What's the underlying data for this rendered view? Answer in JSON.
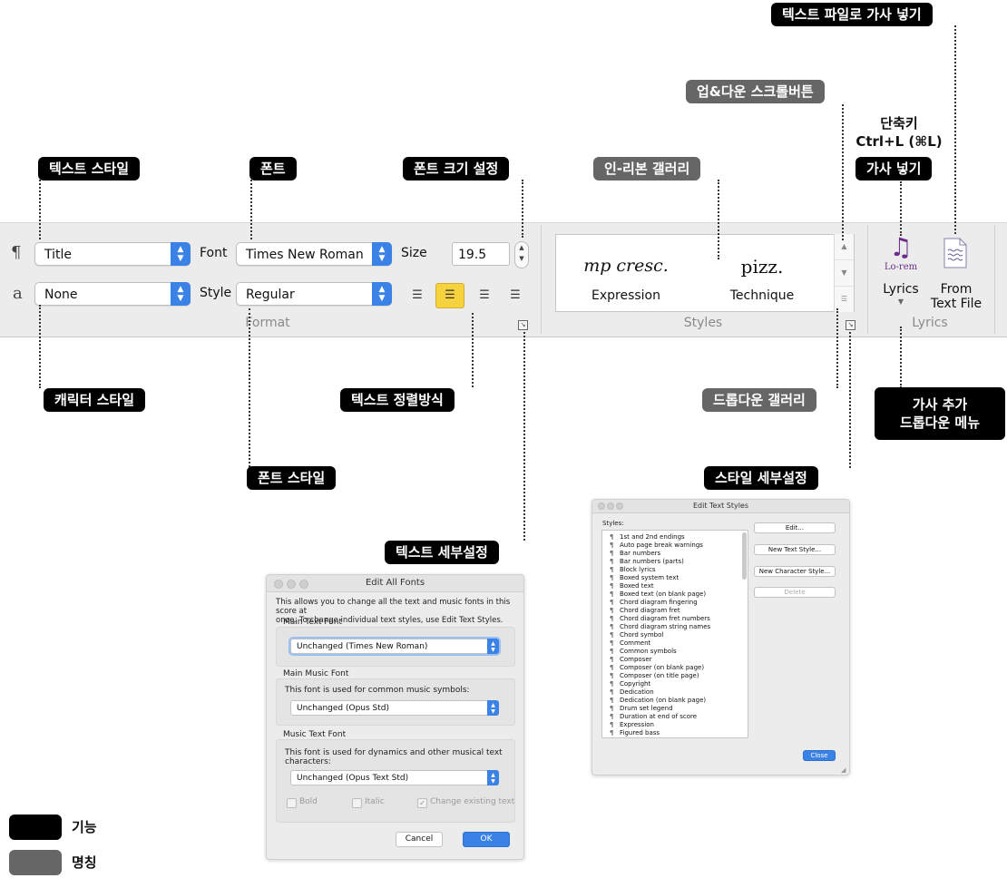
{
  "ribbon": {
    "format": {
      "group_label": "Format",
      "paragraph_icon": "¶",
      "char_icon": "a",
      "text_style": "Title",
      "char_style": "None",
      "font_label": "Font",
      "font_value": "Times New Roman",
      "style_label": "Style",
      "style_value": "Regular",
      "size_label": "Size",
      "size_value": "19.5",
      "align_selected": "center"
    },
    "styles": {
      "group_label": "Styles",
      "items": [
        {
          "preview": "mp cresc.",
          "label": "Expression"
        },
        {
          "preview": "pizz.",
          "label": "Technique"
        }
      ]
    },
    "lyrics": {
      "group_label": "Lyrics",
      "lyrics_icon_text": "Lo-rem",
      "lyrics_button": "Lyrics",
      "from_file_line1": "From",
      "from_file_line2": "Text File"
    }
  },
  "callouts": {
    "text_style": "텍스트 스타일",
    "font": "폰트",
    "font_size": "폰트 크기 설정",
    "inribbon_gallery": "인-리본 갤러리",
    "updown_scroll": "업&다운 스크롤버튼",
    "shortcut_line1": "단축키",
    "shortcut_line2": "Ctrl+L (⌘L)",
    "add_lyrics": "가사 넣기",
    "lyrics_from_file": "텍스트 파일로 가사 넣기",
    "char_style": "캐릭터 스타일",
    "text_align": "텍스트 정렬방식",
    "dropdown_gallery": "드롭다운 갤러리",
    "lyrics_menu_line1": "가사 추가",
    "lyrics_menu_line2": "드롭다운 메뉴",
    "font_style": "폰트 스타일",
    "style_detail": "스타일 세부설정",
    "text_detail": "텍스트 세부설정"
  },
  "edit_all_fonts": {
    "title": "Edit All Fonts",
    "intro_line1": "This allows you to change all the text and music fonts in this score at",
    "intro_line2": "once. To change individual text styles, use Edit Text Styles.",
    "main_text_font_label": "Main Text Font",
    "main_text_font_value": "Unchanged (Times New Roman)",
    "main_music_font_label": "Main Music Font",
    "main_music_desc": "This font is used for common music symbols:",
    "main_music_value": "Unchanged (Opus Std)",
    "music_text_font_label": "Music Text Font",
    "music_text_desc_line1": "This font is used for dynamics and other musical text",
    "music_text_desc_line2": "characters:",
    "music_text_value": "Unchanged (Opus Text Std)",
    "bold": "Bold",
    "italic": "Italic",
    "change_existing": "Change existing text",
    "cancel": "Cancel",
    "ok": "OK"
  },
  "edit_text_styles": {
    "title": "Edit Text Styles",
    "styles_label": "Styles:",
    "items": [
      "1st and 2nd endings",
      "Auto page break warnings",
      "Bar numbers",
      "Bar numbers (parts)",
      "Block lyrics",
      "Boxed system text",
      "Boxed text",
      "Boxed text (on blank page)",
      "Chord diagram fingering",
      "Chord diagram fret",
      "Chord diagram fret numbers",
      "Chord diagram string names",
      "Chord symbol",
      "Comment",
      "Common symbols",
      "Composer",
      "Composer (on blank page)",
      "Composer (on title page)",
      "Copyright",
      "Dedication",
      "Dedication (on blank page)",
      "Drum set legend",
      "Duration at end of score",
      "Expression",
      "Figured bass"
    ],
    "edit_btn": "Edit...",
    "new_text_style": "New Text Style...",
    "new_char_style": "New Character Style...",
    "delete": "Delete",
    "close": "Close"
  },
  "legend": {
    "function": "기능",
    "name": "명칭"
  }
}
